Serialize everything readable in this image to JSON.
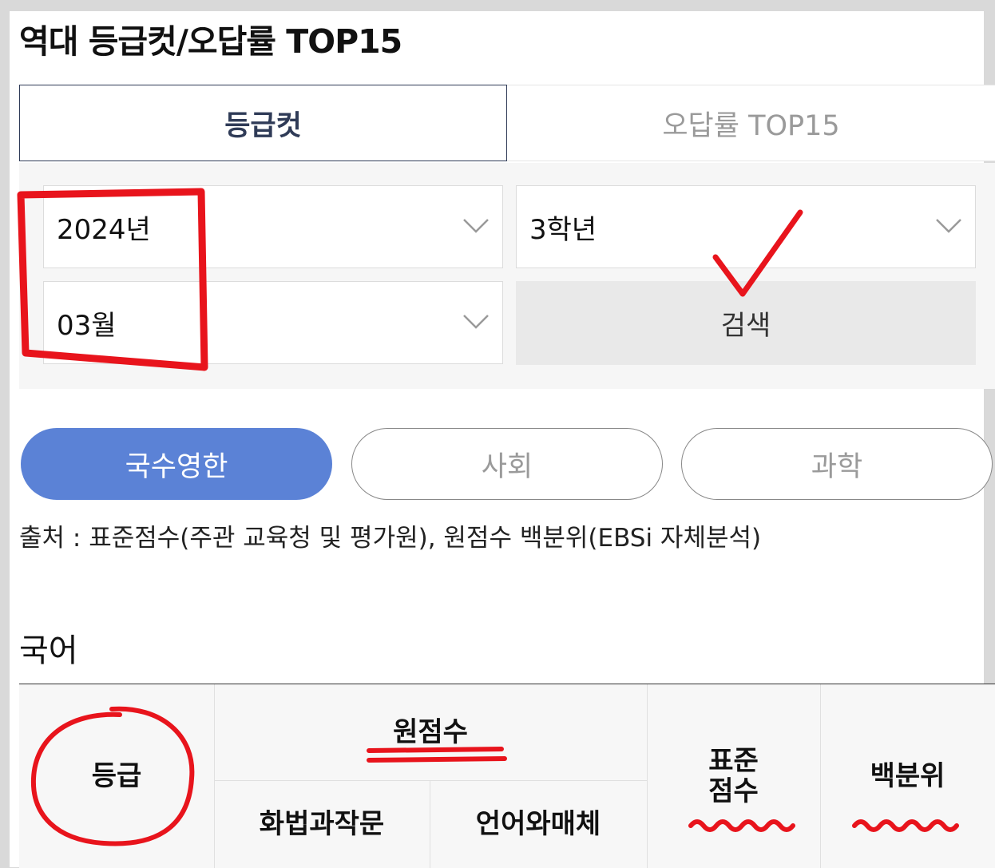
{
  "header": {
    "title": "역대 등급컷/오답률 TOP15"
  },
  "tabs": [
    {
      "label": "등급컷",
      "active": true
    },
    {
      "label": "오답률 TOP15",
      "active": false
    }
  ],
  "filters": {
    "year": "2024년",
    "grade": "3학년",
    "month": "03월",
    "search_label": "검색"
  },
  "subject_tabs": [
    {
      "label": "국수영한",
      "active": true
    },
    {
      "label": "사회",
      "active": false
    },
    {
      "label": "과학",
      "active": false
    }
  ],
  "source_text": "출처 : 표준점수(주관 교육청 및 평가원), 원점수 백분위(EBSi 자체분석)",
  "section_title": "국어",
  "table": {
    "headers": {
      "grade": "등급",
      "raw_score": "원점수",
      "sub1": "화법과작문",
      "sub2": "언어와매체",
      "standard": "표준\n점수",
      "percentile": "백분위"
    }
  },
  "colors": {
    "accent": "#5b82d6",
    "tab_border": "#2f3b57",
    "annotation": "#e8141c"
  },
  "icons": {
    "dropdown": "chevron-down-icon"
  }
}
